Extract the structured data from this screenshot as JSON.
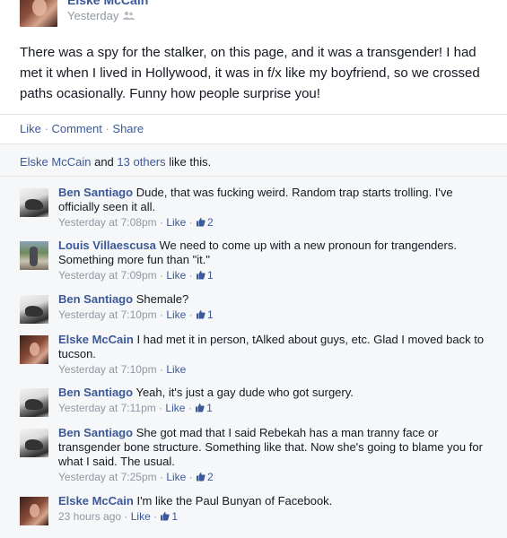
{
  "post": {
    "author": "Elske McCain",
    "time": "Yesterday",
    "text": "There was a spy for the stalker, on this page, and it was a transgender! I had met it when I lived in Hollywood, it was in f/x like my boyfriend, so we crossed paths ocasionally. Funny how people surprise you!",
    "actions": {
      "like": "Like",
      "comment": "Comment",
      "share": "Share",
      "sep": "·"
    }
  },
  "likes": {
    "name": "Elske McCain",
    "and": "and",
    "others": "13 others",
    "suffix": "like this."
  },
  "comments": [
    {
      "author": "Ben Santiago",
      "text": "Dude, that was fucking weird. Random trap starts trolling. I've officially seen it all.",
      "time": "Yesterday at 7:08pm",
      "like": "Like",
      "count": "2"
    },
    {
      "author": "Louis Villaescusa",
      "text": "We need to come up with a new pronoun for trangenders. Something more fun than \"it.\"",
      "time": "Yesterday at 7:09pm",
      "like": "Like",
      "count": "1"
    },
    {
      "author": "Ben Santiago",
      "text": "Shemale?",
      "time": "Yesterday at 7:10pm",
      "like": "Like",
      "count": "1"
    },
    {
      "author": "Elske McCain",
      "text": "I had met it in person, tAlked about guys, etc. Glad I moved back to tucson.",
      "time": "Yesterday at 7:10pm",
      "like": "Like",
      "count": ""
    },
    {
      "author": "Ben Santiago",
      "text": "Yeah, it's just a gay dude who got surgery.",
      "time": "Yesterday at 7:11pm",
      "like": "Like",
      "count": "1"
    },
    {
      "author": "Ben Santiago",
      "text": "She got mad that I said Rebekah has a man tranny face or transgender bone structure. Something like that. Now she's going to blame you for what I said. The usual.",
      "time": "Yesterday at 7:25pm",
      "like": "Like",
      "count": "2"
    },
    {
      "author": "Elske McCain",
      "text": "I'm like the Paul Bunyan of Facebook.",
      "time": "23 hours ago",
      "like": "Like",
      "count": "1"
    }
  ],
  "colors": {
    "link": "#3b5998",
    "meta": "#9197a3",
    "ufi_bg": "#f6f7f8"
  },
  "icons": {
    "audience": "friends-icon",
    "like_count": "thumbs-up-icon"
  }
}
